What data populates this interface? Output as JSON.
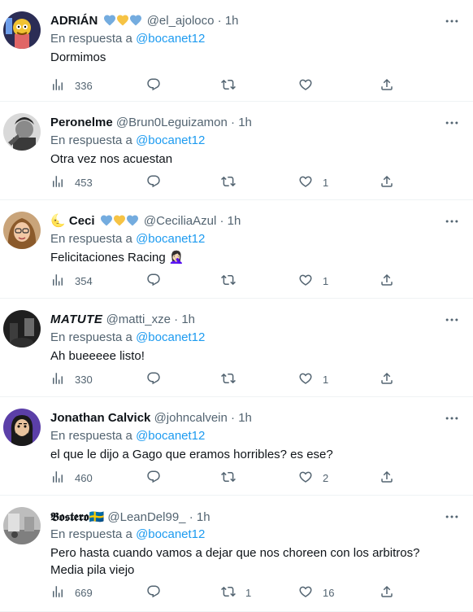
{
  "tweets": [
    {
      "name": "ADRIÁN",
      "hearts": true,
      "handle": "@el_ajoloco",
      "dot": "·",
      "time": "1h",
      "reply_prefix": "En respuesta a",
      "mention": "@bocanet12",
      "text": "Dormimos",
      "views": "336",
      "retweets": "",
      "likes": ""
    },
    {
      "name": "Peronelme",
      "hearts": false,
      "handle": "@Brun0Leguizamon",
      "dot": "·",
      "time": "1h",
      "reply_prefix": "En respuesta a",
      "mention": "@bocanet12",
      "text": "Otra vez nos acuestan",
      "views": "453",
      "retweets": "",
      "likes": "1"
    },
    {
      "name": "Ceci",
      "prefix_emoji": "🌜",
      "hearts": true,
      "handle": "@CeciliaAzul",
      "dot": "·",
      "time": "1h",
      "reply_prefix": "En respuesta a",
      "mention": "@bocanet12",
      "text": "Felicitaciones Racing 🤦🏻‍♀️",
      "views": "354",
      "retweets": "",
      "likes": "1"
    },
    {
      "name": "MATUTE",
      "hearts": false,
      "handle": "@matti_xze",
      "dot": "·",
      "time": "1h",
      "reply_prefix": "En respuesta a",
      "mention": "@bocanet12",
      "text": "Ah bueeeee listo!",
      "views": "330",
      "retweets": "",
      "likes": "1"
    },
    {
      "name": "Jonathan Calvick",
      "hearts": false,
      "handle": "@johncalvein",
      "dot": "·",
      "time": "1h",
      "reply_prefix": "En respuesta a",
      "mention": "@bocanet12",
      "text": "el que le dijo a Gago que eramos horribles? es ese?",
      "views": "460",
      "retweets": "",
      "likes": "2"
    },
    {
      "name": "𝕭𝖔𝖘𝖙𝖊𝖗𝖔",
      "flag": "🇸🇪",
      "hearts": false,
      "handle": "@LeanDel99_",
      "dot": "·",
      "time": "1h",
      "reply_prefix": "En respuesta a",
      "mention": "@bocanet12",
      "text": "Pero hasta cuando vamos a dejar que nos choreen con los arbitros? Media pila viejo",
      "views": "669",
      "retweets": "1",
      "likes": "16"
    }
  ],
  "colors": {
    "text": "#0f1419",
    "muted": "#536471",
    "link": "#1d9bf0",
    "divider": "#eff3f4",
    "heart_blue": "#74acdf",
    "heart_yellow": "#f6c344"
  },
  "icons": [
    "views-icon",
    "reply-icon",
    "retweet-icon",
    "like-icon",
    "share-icon",
    "more-icon"
  ]
}
